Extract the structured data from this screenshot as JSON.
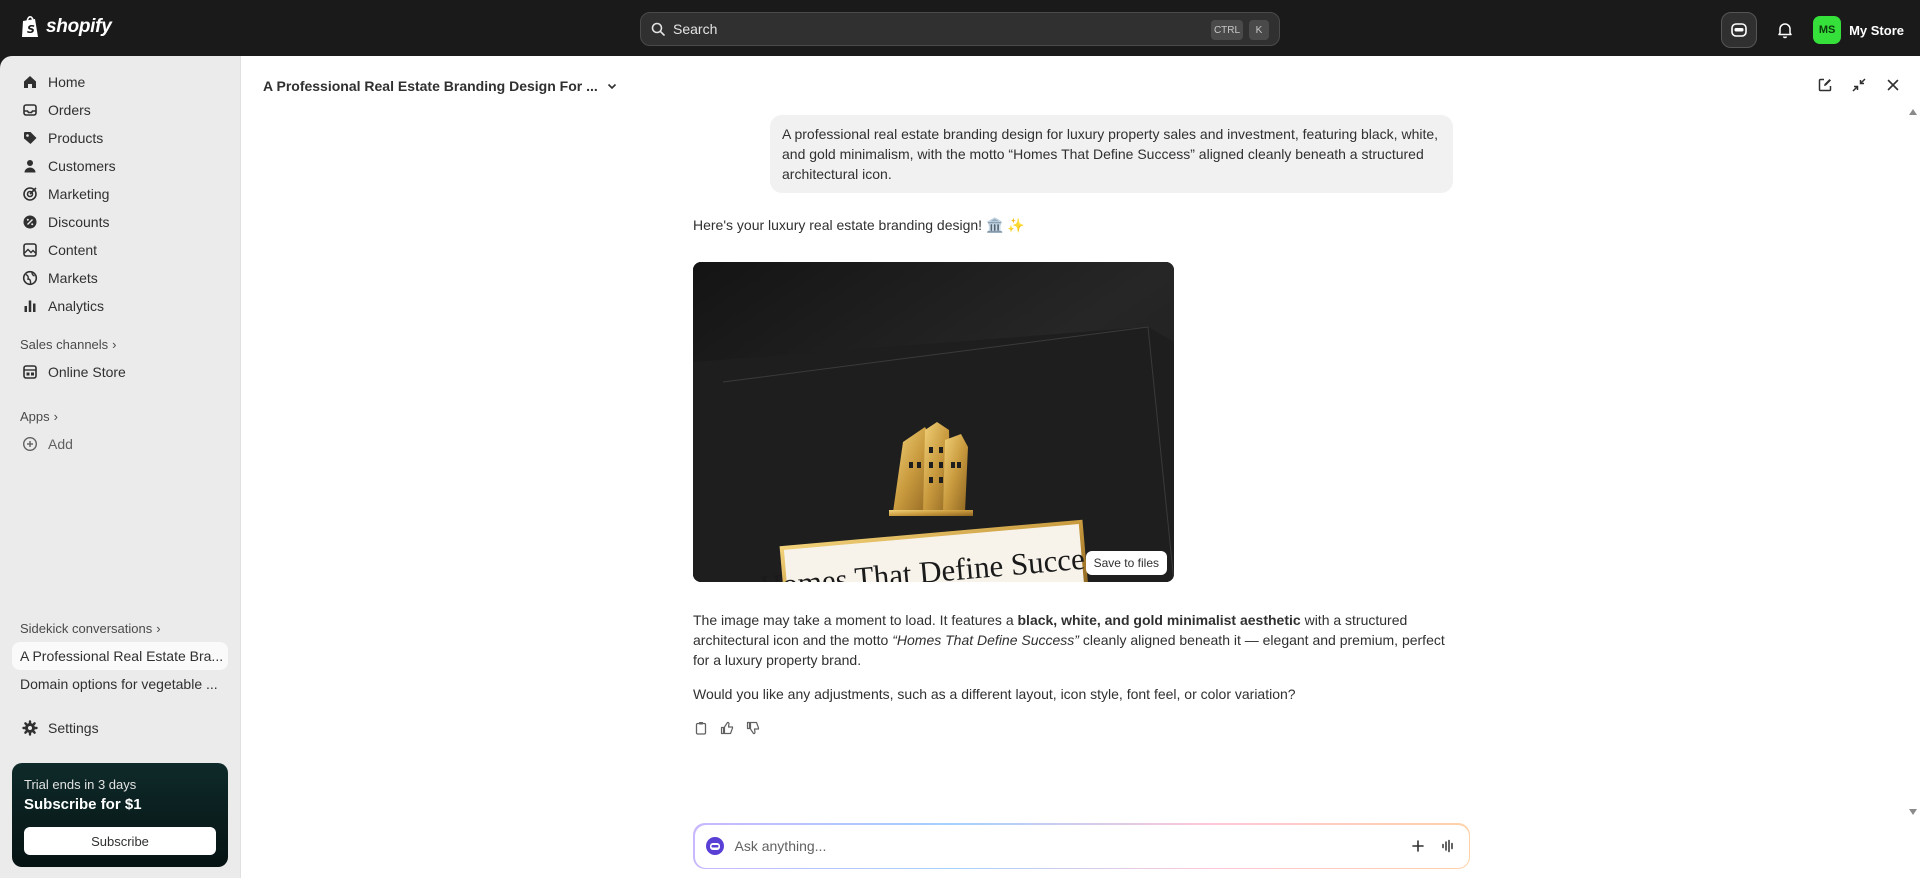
{
  "topbar": {
    "logo_text": "shopify",
    "search_label": "Search",
    "shortcut_ctrl": "CTRL",
    "shortcut_key": "K",
    "store_initials": "MS",
    "store_name": "My Store",
    "avatar_color": "#36e03a"
  },
  "sidebar": {
    "items": [
      {
        "label": "Home",
        "icon": "home-icon"
      },
      {
        "label": "Orders",
        "icon": "inbox-icon"
      },
      {
        "label": "Products",
        "icon": "tag-icon"
      },
      {
        "label": "Customers",
        "icon": "person-icon"
      },
      {
        "label": "Marketing",
        "icon": "target-icon"
      },
      {
        "label": "Discounts",
        "icon": "discount-icon"
      },
      {
        "label": "Content",
        "icon": "content-icon"
      },
      {
        "label": "Markets",
        "icon": "globe-icon"
      },
      {
        "label": "Analytics",
        "icon": "bar-chart-icon"
      }
    ],
    "sales_channels_label": "Sales channels",
    "online_store_label": "Online Store",
    "apps_label": "Apps",
    "add_label": "Add",
    "sidekick_label": "Sidekick conversations",
    "conversations": [
      {
        "label": "A Professional Real Estate Bra...",
        "active": true
      },
      {
        "label": "Domain options for vegetable ...",
        "active": false
      }
    ],
    "settings_label": "Settings",
    "trial": {
      "line1": "Trial ends in 3 days",
      "line2": "Subscribe for $1",
      "button": "Subscribe"
    }
  },
  "main": {
    "conversation_title": "A Professional Real Estate Branding Design For ...",
    "user_message": "A professional real estate branding design for luxury property sales and investment, featuring black, white, and gold minimalism, with the motto “Homes That Define Success” aligned cleanly beneath a structured architectural icon.",
    "reply_intro": "Here's your luxury real estate branding design! 🏛️ ✨",
    "image_motto": "Homes That Define Success",
    "save_button": "Save to files",
    "para1": {
      "a": "The image may take a moment to load. It features a ",
      "b": "black, white, and gold minimalist aesthetic",
      "c": " with a structured architectural icon and the motto ",
      "d": "“Homes That Define Success”",
      "e": " cleanly aligned beneath it — elegant and premium, perfect for a luxury property brand."
    },
    "para2": "Would you like any adjustments, such as a different layout, icon style, font feel, or color variation?",
    "composer_placeholder": "Ask anything..."
  }
}
